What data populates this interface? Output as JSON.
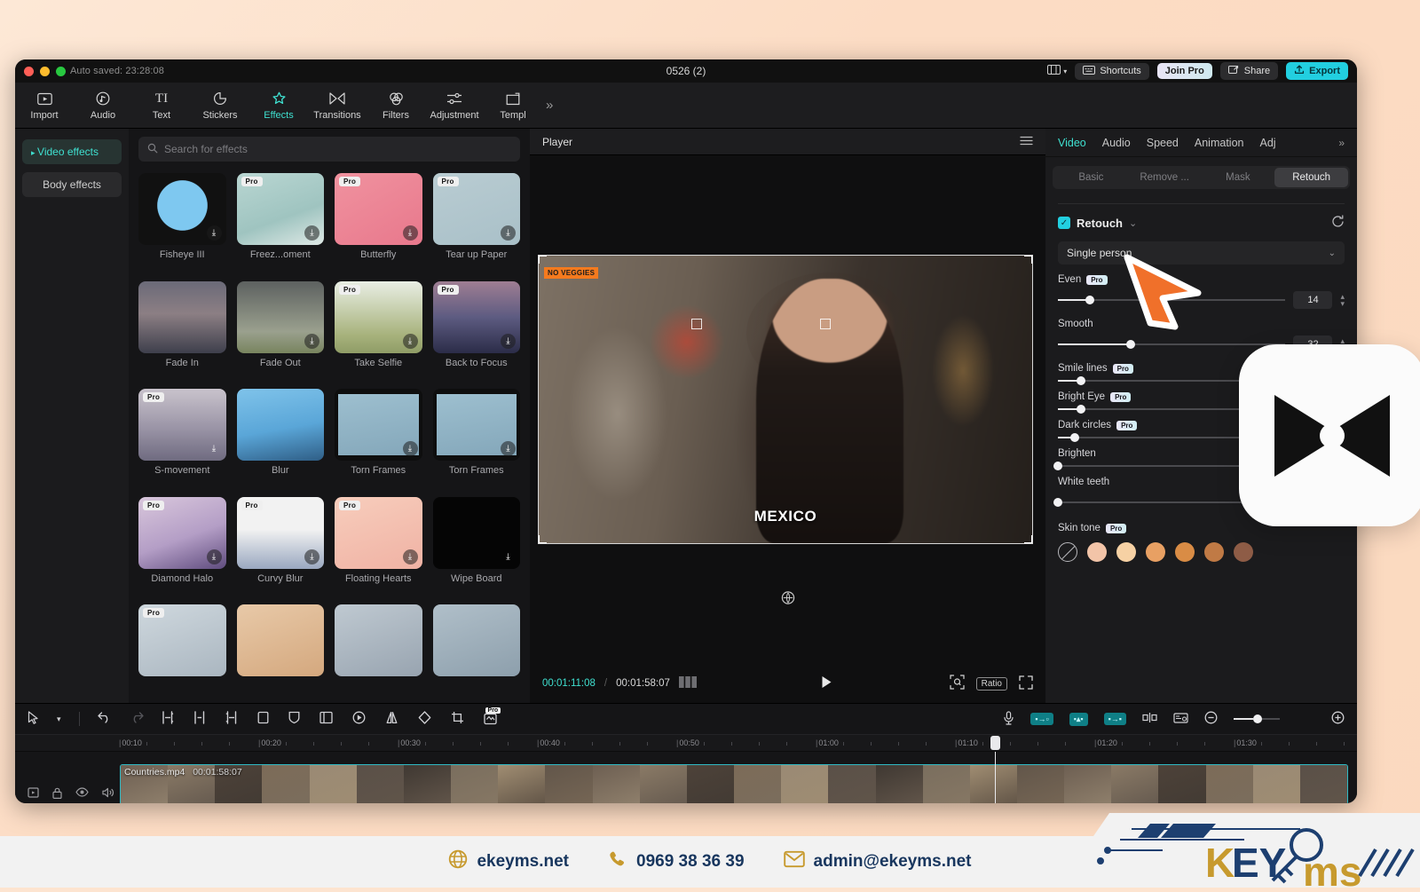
{
  "window": {
    "autosave": "Auto saved: 23:28:08",
    "title": "0526 (2)",
    "layout_icon": "layout-icon",
    "shortcuts_label": "Shortcuts",
    "join_pro_label": "Join Pro",
    "share_label": "Share",
    "export_label": "Export"
  },
  "ribbon": {
    "items": [
      {
        "label": "Import",
        "icon": "import-icon",
        "glyph": "▣"
      },
      {
        "label": "Audio",
        "icon": "audio-icon",
        "glyph": "♪"
      },
      {
        "label": "Text",
        "icon": "text-icon",
        "glyph": "TI"
      },
      {
        "label": "Stickers",
        "icon": "stickers-icon",
        "glyph": "◗"
      },
      {
        "label": "Effects",
        "icon": "effects-icon",
        "glyph": "✦"
      },
      {
        "label": "Transitions",
        "icon": "transitions-icon",
        "glyph": "⋈"
      },
      {
        "label": "Filters",
        "icon": "filters-icon",
        "glyph": "◔"
      },
      {
        "label": "Adjustment",
        "icon": "adjustment-icon",
        "glyph": "⚌"
      },
      {
        "label": "Templ",
        "icon": "template-icon",
        "glyph": "❏"
      }
    ],
    "active": "Effects",
    "more": "»"
  },
  "left_panel": {
    "categories": [
      {
        "label": "Video effects",
        "active": true
      },
      {
        "label": "Body effects",
        "active": false
      }
    ]
  },
  "effects_panel": {
    "search_placeholder": "Search for effects",
    "items": [
      {
        "label": "Fisheye III",
        "pro": false,
        "download": true,
        "art": "t-fisheye"
      },
      {
        "label": "Freez...oment",
        "pro": true,
        "download": true,
        "art": "t-freeze"
      },
      {
        "label": "Butterfly",
        "pro": true,
        "download": true,
        "art": "t-butter"
      },
      {
        "label": "Tear up Paper",
        "pro": true,
        "download": true,
        "art": "t-tear"
      },
      {
        "label": "Fade In",
        "pro": false,
        "download": false,
        "art": "t-fadein"
      },
      {
        "label": "Fade Out",
        "pro": false,
        "download": true,
        "art": "t-fadeout"
      },
      {
        "label": "Take Selfie",
        "pro": true,
        "download": true,
        "art": "t-selfie"
      },
      {
        "label": "Back to Focus",
        "pro": true,
        "download": true,
        "art": "t-backfoc"
      },
      {
        "label": "S-movement",
        "pro": true,
        "download": true,
        "art": "t-smove"
      },
      {
        "label": "Blur",
        "pro": false,
        "download": false,
        "art": "t-blur"
      },
      {
        "label": "Torn Frames",
        "pro": false,
        "download": true,
        "art": "t-torn"
      },
      {
        "label": "Torn Frames",
        "pro": false,
        "download": true,
        "art": "t-torn"
      },
      {
        "label": "Diamond Halo",
        "pro": true,
        "download": true,
        "art": "t-diamond"
      },
      {
        "label": "Curvy Blur",
        "pro": true,
        "download": true,
        "art": "t-curvy"
      },
      {
        "label": "Floating Hearts",
        "pro": true,
        "download": true,
        "art": "t-hearts"
      },
      {
        "label": "Wipe Board",
        "pro": false,
        "download": true,
        "art": "t-wipe"
      },
      {
        "label": "",
        "pro": true,
        "download": false,
        "art": "t-row5a"
      },
      {
        "label": "",
        "pro": false,
        "download": false,
        "art": "t-row5b"
      },
      {
        "label": "",
        "pro": false,
        "download": false,
        "art": "t-row5c"
      },
      {
        "label": "",
        "pro": false,
        "download": false,
        "art": "t-row5d"
      }
    ],
    "pro_badge": "Pro"
  },
  "player": {
    "title": "Player",
    "menu_icon": "hamburger-icon",
    "overlay_badge": "NO VEGGIES",
    "caption": "MEXICO",
    "current_time": "00:01:11:08",
    "total_time": "00:01:58:07",
    "separator": "/",
    "ratio_label": "Ratio"
  },
  "inspector": {
    "tabs": [
      {
        "label": "Video",
        "active": true
      },
      {
        "label": "Audio",
        "active": false
      },
      {
        "label": "Speed",
        "active": false
      },
      {
        "label": "Animation",
        "active": false
      },
      {
        "label": "Adj",
        "active": false
      }
    ],
    "more_chevron": "»",
    "segments": [
      {
        "label": "Basic",
        "active": false
      },
      {
        "label": "Remove ...",
        "active": false
      },
      {
        "label": "Mask",
        "active": false
      },
      {
        "label": "Retouch",
        "active": true
      }
    ],
    "retouch": {
      "enabled_label": "Retouch",
      "dash": "⌄",
      "reset_icon": "reset-icon",
      "mode_value": "Single person",
      "pro_badge": "Pro",
      "sliders": [
        {
          "name": "Even",
          "pro": true,
          "value": "14",
          "percent": 14,
          "show_box": true
        },
        {
          "name": "Smooth",
          "pro": false,
          "value": "32",
          "percent": 32,
          "show_box": true
        },
        {
          "name": "Smile lines",
          "pro": true,
          "value": "8",
          "percent": 8,
          "show_box": false
        },
        {
          "name": "Bright Eye",
          "pro": true,
          "value": "8",
          "percent": 8,
          "show_box": false
        },
        {
          "name": "Dark circles",
          "pro": true,
          "value": "6",
          "percent": 6,
          "show_box": false
        },
        {
          "name": "Brighten",
          "pro": false,
          "value": "0",
          "percent": 0,
          "show_box": false
        },
        {
          "name": "White teeth",
          "pro": false,
          "value": "0",
          "percent": 0,
          "show_box": true
        }
      ],
      "skin_tone_label": "Skin tone",
      "skin_tones": [
        "none",
        "#f2c4a8",
        "#f6d1a4",
        "#e8a063",
        "#d98c45",
        "#c07a45",
        "#8e5c46"
      ]
    }
  },
  "timeline": {
    "toolbar": {
      "left_icons": [
        "select-arrow-icon",
        "chevron-down-icon",
        "undo-icon",
        "redo-icon"
      ],
      "edit_icons": [
        "split-left-icon",
        "split-icon",
        "split-right-icon",
        "delete-icon",
        "shield-icon",
        "crop-frame-icon",
        "keyframe-icon",
        "mirror-icon",
        "rotate-icon",
        "crop-icon",
        "auto-caption-icon"
      ],
      "right_icons": [
        "microphone-icon",
        "caption-a-icon",
        "caption-b-icon",
        "caption-c-icon",
        "align-icon",
        "snapshot-icon",
        "zoom-out-icon"
      ],
      "pro_badge": "Pro"
    },
    "ruler_ticks": [
      "00:10",
      "00:20",
      "00:30",
      "00:40",
      "00:50",
      "01:00",
      "01:10",
      "01:20",
      "01:30"
    ],
    "track_controls": [
      "lock-all-icon",
      "lock-icon",
      "eye-icon",
      "mute-icon"
    ],
    "clip": {
      "name": "Countries.mp4",
      "duration": "00:01:58:07"
    }
  },
  "footer": {
    "website": "ekeyms.net",
    "phone": "0969 38 36 39",
    "email": "admin@ekeyms.net",
    "logo_text_1": "KEY",
    "logo_text_2": "ms",
    "globe_icon": "globe-icon",
    "phone_icon": "phone-icon",
    "mail_icon": "mail-icon"
  },
  "overlays": {
    "cursor_icon": "cursor-arrow-icon",
    "capcut_icon": "capcut-logo-icon"
  }
}
